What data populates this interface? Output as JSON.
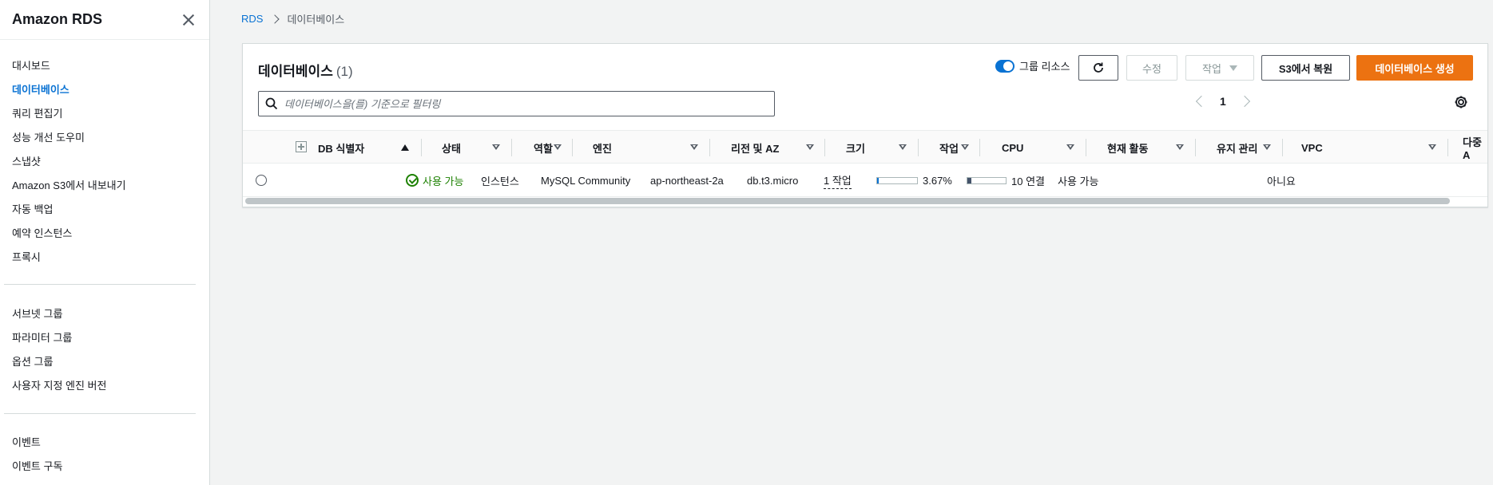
{
  "sidebar": {
    "title": "Amazon RDS",
    "group1": [
      {
        "label": "대시보드",
        "active": false
      },
      {
        "label": "데이터베이스",
        "active": true
      },
      {
        "label": "쿼리 편집기",
        "active": false
      },
      {
        "label": "성능 개선 도우미",
        "active": false
      },
      {
        "label": "스냅샷",
        "active": false
      },
      {
        "label": "Amazon S3에서 내보내기",
        "active": false
      },
      {
        "label": "자동 백업",
        "active": false
      },
      {
        "label": "예약 인스턴스",
        "active": false
      },
      {
        "label": "프록시",
        "active": false
      }
    ],
    "group2": [
      {
        "label": "서브넷 그룹"
      },
      {
        "label": "파라미터 그룹"
      },
      {
        "label": "옵션 그룹"
      },
      {
        "label": "사용자 지정 엔진 버전"
      }
    ],
    "group3": [
      {
        "label": "이벤트"
      },
      {
        "label": "이벤트 구독"
      }
    ]
  },
  "breadcrumb": {
    "root": "RDS",
    "current": "데이터베이스"
  },
  "panel": {
    "title": "데이터베이스",
    "count": "(1)",
    "group_toggle_label": "그룹 리소스",
    "modify_label": "수정",
    "actions_label": "작업",
    "restore_label": "S3에서 복원",
    "create_label": "데이터베이스 생성",
    "search_placeholder": "데이터베이스을(를) 기준으로 필터링",
    "page": "1"
  },
  "table": {
    "headers": {
      "db_id": "DB 식별자",
      "status": "상태",
      "role": "역할",
      "engine": "엔진",
      "region_az": "리전 및 AZ",
      "size": "크기",
      "actions": "작업",
      "cpu": "CPU",
      "current_activity": "현재 활동",
      "maintenance": "유지 관리",
      "vpc": "VPC",
      "multi_az": "다중 A"
    },
    "rows": [
      {
        "db_id": "",
        "status": "사용 가능",
        "role": "인스턴스",
        "engine": "MySQL Community",
        "region_az": "ap-northeast-2a",
        "size": "db.t3.micro",
        "actions": "1 작업",
        "cpu_percent": 3.67,
        "cpu": "3.67%",
        "activity_fraction": 0.1,
        "current_activity": "10 연결",
        "maintenance": "사용 가능",
        "vpc": "",
        "multi_az": "아니요"
      }
    ]
  },
  "colors": {
    "link": "#0972d3",
    "primary_button": "#ec7211",
    "status_ok": "#1d8102"
  },
  "icons": [
    "close-icon",
    "chevron-right-icon",
    "refresh-icon",
    "search-icon",
    "settings-gear-icon",
    "check-circle-icon"
  ]
}
